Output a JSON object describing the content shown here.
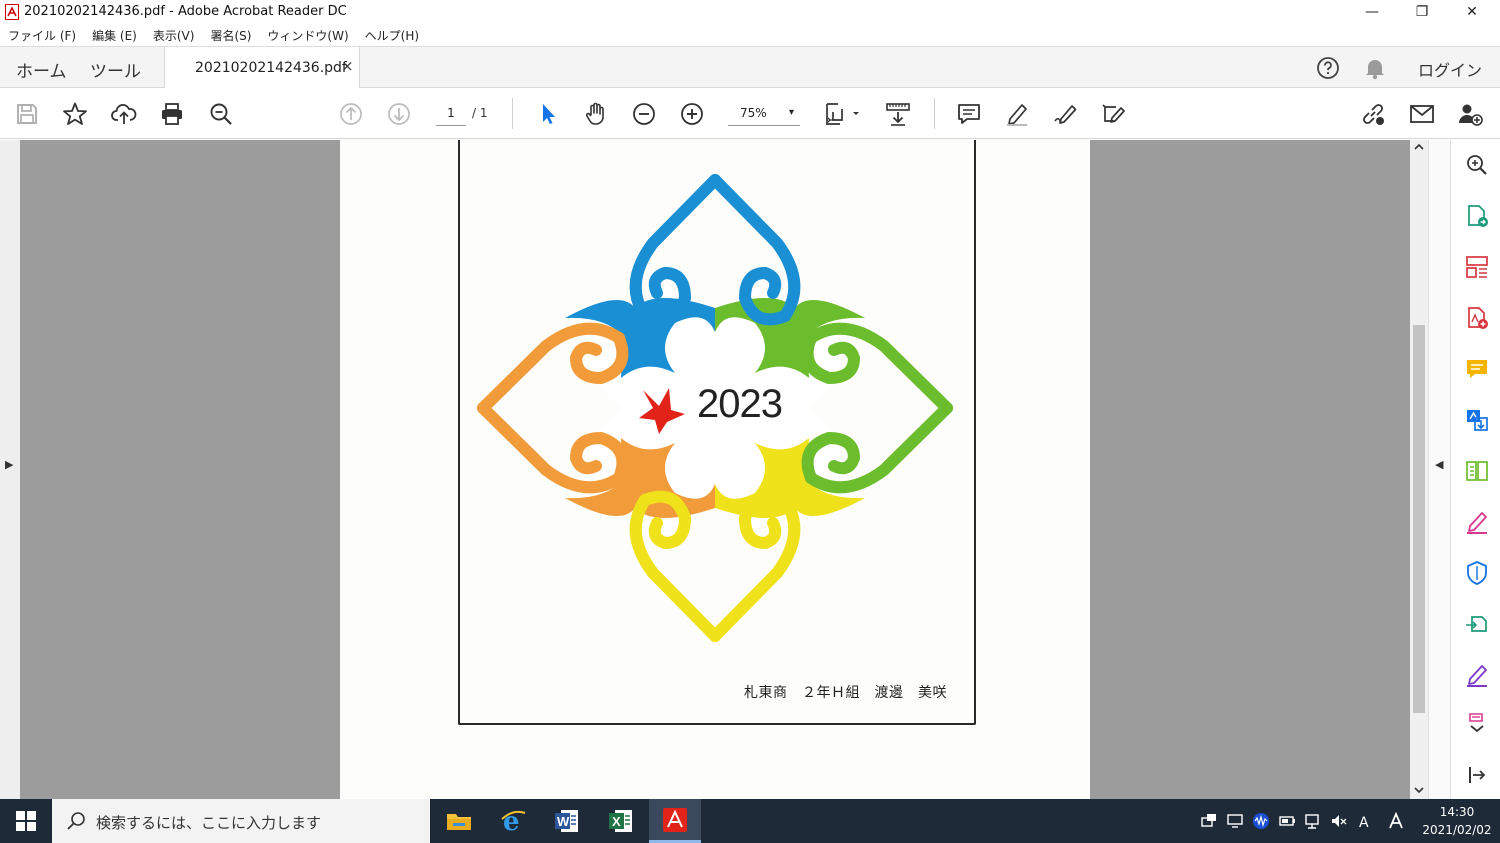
{
  "window": {
    "title": "20210202142436.pdf - Adobe Acrobat Reader DC",
    "minimize": "—",
    "maximize": "❐",
    "close": "✕"
  },
  "menu": [
    "ファイル (F)",
    "編集 (E)",
    "表示(V)",
    "署名(S)",
    "ウィンドウ(W)",
    "ヘルプ(H)"
  ],
  "tabs": {
    "home": "ホーム",
    "tools": "ツール",
    "document": "20210202142436.pdf",
    "close_glyph": "×",
    "login": "ログイン"
  },
  "toolbar": {
    "page_current": "1",
    "page_total": "/ 1",
    "zoom": "75%",
    "zoom_arrow": "▾"
  },
  "document": {
    "logo_year": "2023",
    "caption": "札東商　２年Ｈ組　渡邊　美咲"
  },
  "sidebar_toggles": {
    "left": "▶",
    "right": "◀"
  },
  "taskbar": {
    "search_placeholder": "検索するには、ここに入力します",
    "time": "14:30",
    "date": "2021/02/02"
  },
  "colors": {
    "blue": "#1a8fd4",
    "green": "#6cbd2e",
    "orange": "#f29b3a",
    "yellow": "#f0e21a",
    "red": "#e2231a",
    "taskbar": "#1e2a38"
  }
}
